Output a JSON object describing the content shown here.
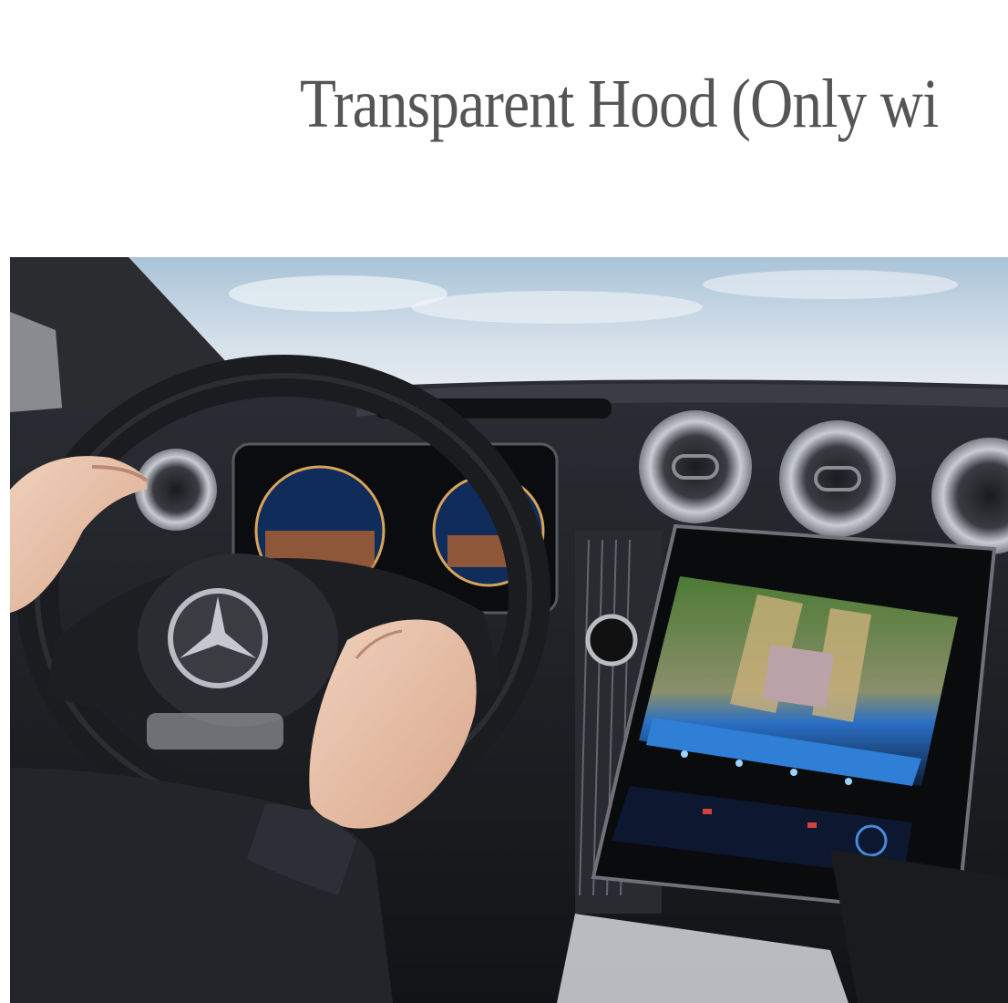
{
  "feature": {
    "title": "Transparent Hood (Only wi"
  },
  "hero_image": {
    "subject": "car-interior-driver-view",
    "icons": [
      "steering-wheel-icon",
      "brand-star-logo-icon",
      "air-vent-icon",
      "infotainment-screen-icon",
      "instrument-cluster-icon"
    ]
  },
  "colors": {
    "title_text": "#555555",
    "background": "#ffffff",
    "dashboard": "#1c1e22",
    "sky": "#c9d8e4",
    "screen_accent": "#2f7fd6",
    "camera_green": "#5f8a3a"
  }
}
